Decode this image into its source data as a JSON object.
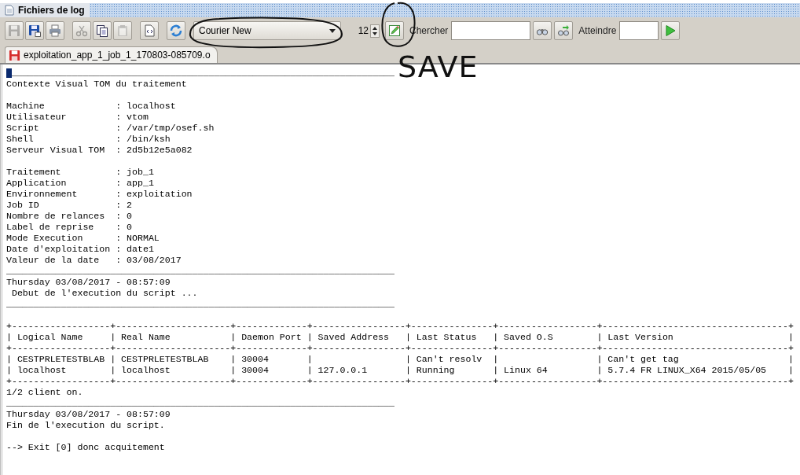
{
  "window": {
    "title": "Fichiers de log"
  },
  "toolbar": {
    "buttons": [
      {
        "kind": "save",
        "disabled": true
      },
      {
        "kind": "save-as",
        "disabled": false
      },
      {
        "kind": "print",
        "disabled": false
      },
      {
        "kind": "cut",
        "disabled": true
      },
      {
        "kind": "copy",
        "disabled": false
      },
      {
        "kind": "paste",
        "disabled": true
      },
      {
        "kind": "source",
        "disabled": false
      },
      {
        "kind": "refresh",
        "disabled": false
      }
    ],
    "font": {
      "value": "Courier New"
    },
    "size": {
      "value": "12"
    },
    "edit_button": {
      "kind": "edit"
    },
    "search": {
      "label": "Chercher"
    },
    "search_buttons": [
      {
        "kind": "find"
      },
      {
        "kind": "find-next"
      }
    ],
    "goto": {
      "label": "Atteindre"
    },
    "go_button": {
      "kind": "go"
    }
  },
  "tabs": [
    {
      "label": "exploitation_app_1_job_1_170803-085709.o",
      "selected": true
    }
  ],
  "log": {
    "lines": [
      {
        "kind": "text",
        "text": "______________________________________________________________________",
        "cursor": true
      },
      {
        "kind": "text",
        "text": "Contexte Visual TOM du traitement",
        "cursor": false
      },
      {
        "kind": "blank"
      },
      {
        "kind": "text",
        "text": "Machine             : localhost",
        "cursor": false
      },
      {
        "kind": "text",
        "text": "Utilisateur         : vtom",
        "cursor": false
      },
      {
        "kind": "text",
        "text": "Script              : /var/tmp/osef.sh",
        "cursor": false
      },
      {
        "kind": "text",
        "text": "Shell               : /bin/ksh",
        "cursor": false
      },
      {
        "kind": "text",
        "text": "Serveur Visual TOM  : 2d5b12e5a082",
        "cursor": false
      },
      {
        "kind": "blank"
      },
      {
        "kind": "text",
        "text": "Traitement          : job_1",
        "cursor": false
      },
      {
        "kind": "text",
        "text": "Application         : app_1",
        "cursor": false
      },
      {
        "kind": "text",
        "text": "Environnement       : exploitation",
        "cursor": false
      },
      {
        "kind": "text",
        "text": "Job ID              : 2",
        "cursor": false
      },
      {
        "kind": "text",
        "text": "Nombre de relances  : 0",
        "cursor": false
      },
      {
        "kind": "text",
        "text": "Label de reprise    : 0",
        "cursor": false
      },
      {
        "kind": "text",
        "text": "Mode Execution      : NORMAL",
        "cursor": false
      },
      {
        "kind": "text",
        "text": "Date d'exploitation : date1",
        "cursor": false
      },
      {
        "kind": "text",
        "text": "Valeur de la date   : 03/08/2017",
        "cursor": false
      },
      {
        "kind": "text",
        "text": "_______________________________________________________________________",
        "cursor": false
      },
      {
        "kind": "text",
        "text": "Thursday 03/08/2017 - 08:57:09",
        "cursor": false
      },
      {
        "kind": "text",
        "text": " Debut de l'execution du script ...",
        "cursor": false
      },
      {
        "kind": "text",
        "text": "_______________________________________________________________________",
        "cursor": false
      },
      {
        "kind": "blank"
      },
      {
        "kind": "text",
        "text": "+------------------+---------------------+-------------+-----------------+---------------+------------------+----------------------------------+",
        "cursor": false
      },
      {
        "kind": "text",
        "text": "| Logical Name     | Real Name           | Daemon Port | Saved Address   | Last Status   | Saved O.S        | Last Version                     |",
        "cursor": false
      },
      {
        "kind": "text",
        "text": "+------------------+---------------------+-------------+-----------------+---------------+------------------+----------------------------------+",
        "cursor": false
      },
      {
        "kind": "text",
        "text": "| CESTPRLETESTBLAB | CESTPRLETESTBLAB    | 30004       |                 | Can't resolv  |                  | Can't get tag                    |",
        "cursor": false
      },
      {
        "kind": "text",
        "text": "| localhost        | localhost           | 30004       | 127.0.0.1       | Running       | Linux 64         | 5.7.4 FR LINUX_X64 2015/05/05    |",
        "cursor": false
      },
      {
        "kind": "text",
        "text": "+------------------+---------------------+-------------+-----------------+---------------+------------------+----------------------------------+",
        "cursor": false
      },
      {
        "kind": "text",
        "text": "1/2 client on.",
        "cursor": false
      },
      {
        "kind": "text",
        "text": "_______________________________________________________________________",
        "cursor": false
      },
      {
        "kind": "text",
        "text": "Thursday 03/08/2017 - 08:57:09",
        "cursor": false
      },
      {
        "kind": "text",
        "text": "Fin de l'execution du script.",
        "cursor": false
      },
      {
        "kind": "blank"
      },
      {
        "kind": "text",
        "text": "--> Exit [0] donc acquitement",
        "cursor": false
      }
    ]
  },
  "annotations": [
    {
      "kind": "circle"
    },
    {
      "kind": "circle"
    },
    {
      "kind": "note",
      "text": "SAVE"
    }
  ]
}
